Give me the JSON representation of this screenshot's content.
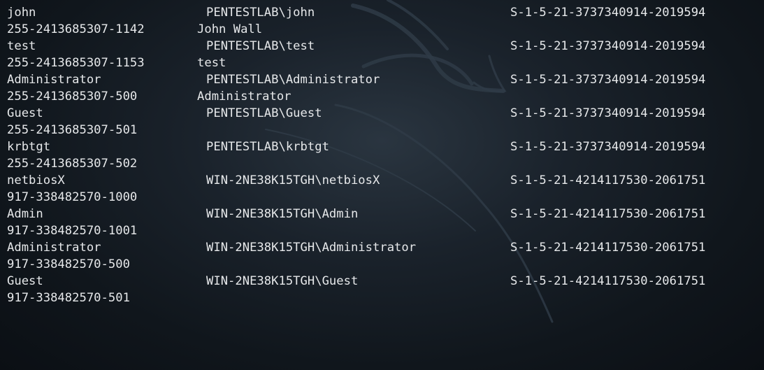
{
  "terminal": {
    "entries": [
      {
        "user": "john",
        "domain_user": "PENTESTLAB\\john",
        "sid": "S-1-5-21-3737340914-2019594",
        "rid_tail": "255-2413685307-1142",
        "fullname": "John Wall"
      },
      {
        "user": "test",
        "domain_user": "PENTESTLAB\\test",
        "sid": "S-1-5-21-3737340914-2019594",
        "rid_tail": "255-2413685307-1153",
        "fullname": "test"
      },
      {
        "user": "Administrator",
        "domain_user": "PENTESTLAB\\Administrator",
        "sid": "S-1-5-21-3737340914-2019594",
        "rid_tail": "255-2413685307-500",
        "fullname": "Administrator"
      },
      {
        "user": "Guest",
        "domain_user": "PENTESTLAB\\Guest",
        "sid": "S-1-5-21-3737340914-2019594",
        "rid_tail": "255-2413685307-501",
        "fullname": ""
      },
      {
        "user": "krbtgt",
        "domain_user": "PENTESTLAB\\krbtgt",
        "sid": "S-1-5-21-3737340914-2019594",
        "rid_tail": "255-2413685307-502",
        "fullname": ""
      },
      {
        "user": "netbiosX",
        "domain_user": "WIN-2NE38K15TGH\\netbiosX",
        "sid": "S-1-5-21-4214117530-2061751",
        "rid_tail": "917-338482570-1000",
        "fullname": ""
      },
      {
        "user": "Admin",
        "domain_user": "WIN-2NE38K15TGH\\Admin",
        "sid": "S-1-5-21-4214117530-2061751",
        "rid_tail": "917-338482570-1001",
        "fullname": ""
      },
      {
        "user": "Administrator",
        "domain_user": "WIN-2NE38K15TGH\\Administrator",
        "sid": "S-1-5-21-4214117530-2061751",
        "rid_tail": "917-338482570-500",
        "fullname": ""
      },
      {
        "user": "Guest",
        "domain_user": "WIN-2NE38K15TGH\\Guest",
        "sid": "S-1-5-21-4214117530-2061751",
        "rid_tail": "917-338482570-501",
        "fullname": ""
      }
    ]
  }
}
